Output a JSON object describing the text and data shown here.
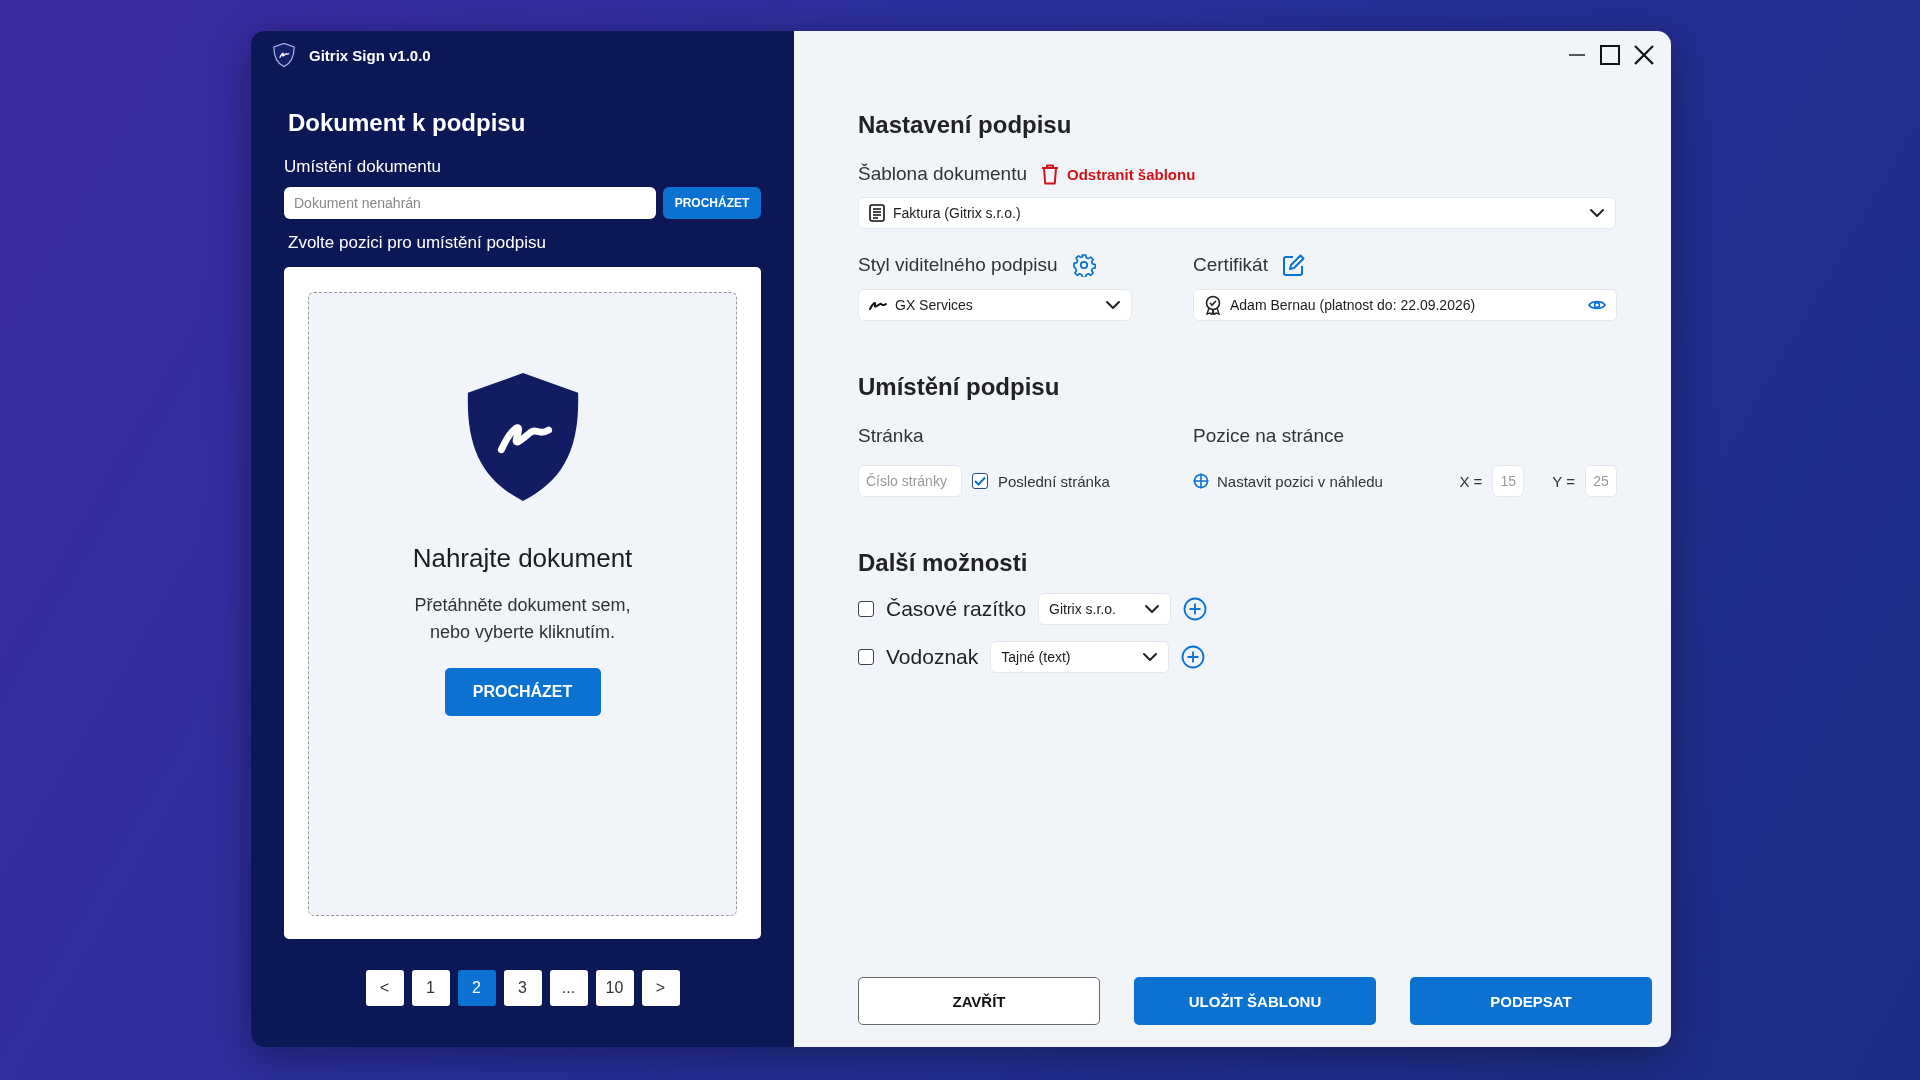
{
  "window": {
    "title": "Gitrix Sign v1.0.0"
  },
  "document_panel": {
    "heading": "Dokument k podpisu",
    "location_label": "Umístění dokumentu",
    "location_field": {
      "placeholder": "Dokument nenahrán"
    },
    "browse_button": "PROCHÁZET",
    "position_label": "Zvolte pozici pro umístění podpisu",
    "drop_zone": {
      "title": "Nahrajte dokument",
      "text": "Přetáhněte dokument sem,\nnebo vyberte kliknutím.",
      "button": "PROCHÁZET"
    },
    "pagination": [
      {
        "label": "<",
        "selected": false
      },
      {
        "label": "1",
        "selected": false
      },
      {
        "label": "2",
        "selected": true
      },
      {
        "label": "3",
        "selected": false
      },
      {
        "label": "...",
        "selected": false
      },
      {
        "label": "10",
        "selected": false
      },
      {
        "label": ">",
        "selected": false
      }
    ]
  },
  "settings_panel": {
    "heading": "Nastavení podpisu",
    "template_label": "Šablona dokumentu",
    "remove_template": "Odstranit šablonu",
    "template_select": "Faktura (Gitrix s.r.o.)",
    "style_label": "Styl viditelného podpisu",
    "style_select": "GX Services",
    "certificate_label": "Certifikát",
    "certificate_select": "Adam Bernau (platnost do: 22.09.2026)"
  },
  "placement": {
    "heading": "Umístění podpisu",
    "page_label": "Stránka",
    "page_field": {
      "placeholder": "Číslo stránky"
    },
    "last_page": {
      "label": "Poslední stránka",
      "checked": true
    },
    "position_label": "Pozice na stránce",
    "set_position_link": "Nastavit pozici v náhledu",
    "x_label": "X =",
    "x_field": {
      "placeholder": "15"
    },
    "y_label": "Y =",
    "y_field": {
      "placeholder": "25"
    }
  },
  "more_options": {
    "heading": "Další možnosti",
    "options": [
      {
        "label": "Časové razítko",
        "checked": false,
        "select": "Gitrix s.r.o."
      },
      {
        "label": "Vodoznak",
        "checked": false,
        "select": "Tajné (text)"
      }
    ]
  },
  "buttons": [
    {
      "label": "ZAVŘÍT",
      "kind": "secondary"
    },
    {
      "label": "ULOŽIT ŠABLONU",
      "kind": "primary"
    },
    {
      "label": "PODEPSAT",
      "kind": "primary"
    }
  ]
}
